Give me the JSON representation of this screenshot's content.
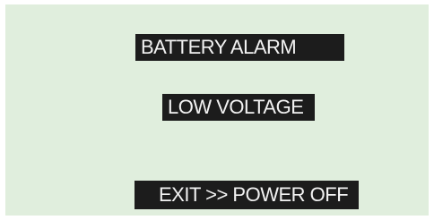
{
  "screen": {
    "background_color": "#e0eedd",
    "highlight_color": "#1c1c1c",
    "text_color": "#f2f2f2",
    "alarm_title": "BATTERY ALARM",
    "alarm_message": "LOW VOLTAGE",
    "exit_action": "EXIT >> POWER OFF"
  }
}
